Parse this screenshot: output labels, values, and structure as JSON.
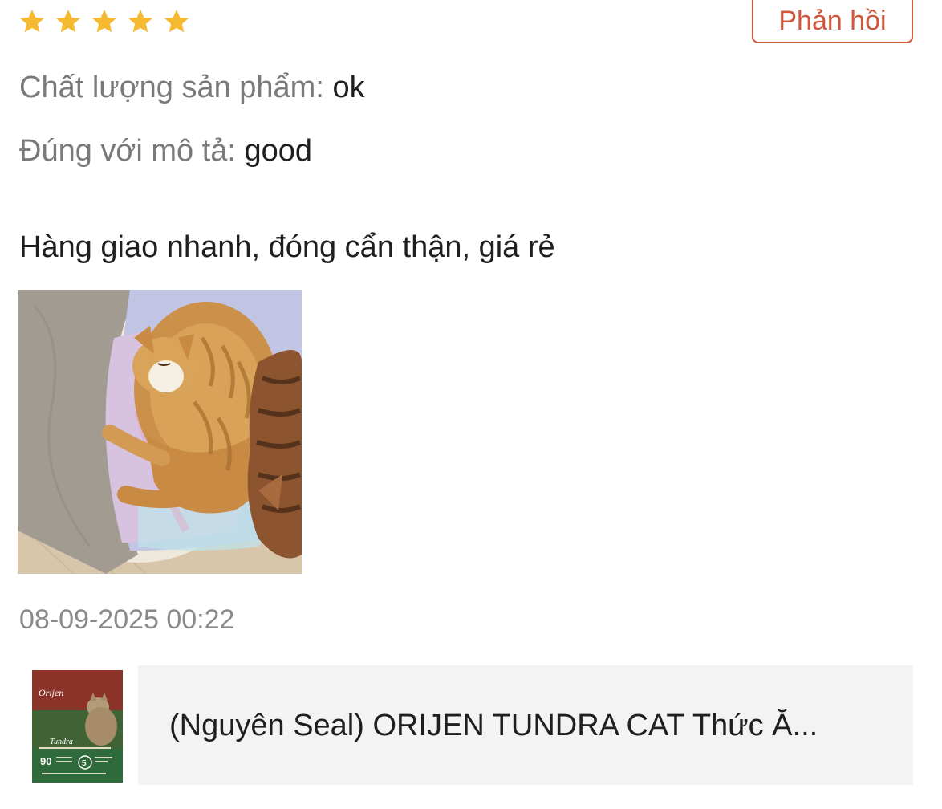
{
  "review": {
    "rating": 5,
    "rating_max": 5,
    "star_color": "#f5b932",
    "reply_label": "Phản hồi",
    "attributes": [
      {
        "label": "Chất lượng sản phẩm:",
        "value": "ok"
      },
      {
        "label": "Đúng với mô tả:",
        "value": "good"
      }
    ],
    "comment": "Hàng giao nhanh, đóng cẩn thận, giá rẻ",
    "photo_icon": "cat-sleeping-photo",
    "timestamp": "08-09-2025 00:22"
  },
  "product": {
    "title": "(Nguyên Seal) ORIJEN TUNDRA CAT Thức Ă...",
    "thumbnail_icon": "orijen-bag-thumbnail",
    "brand_mark": "Orijen",
    "variant_mark": "Tundra",
    "badge_left": "90",
    "badge_right": "5",
    "card_color": "#f3f3f3",
    "accent_color": "#d0573b"
  }
}
